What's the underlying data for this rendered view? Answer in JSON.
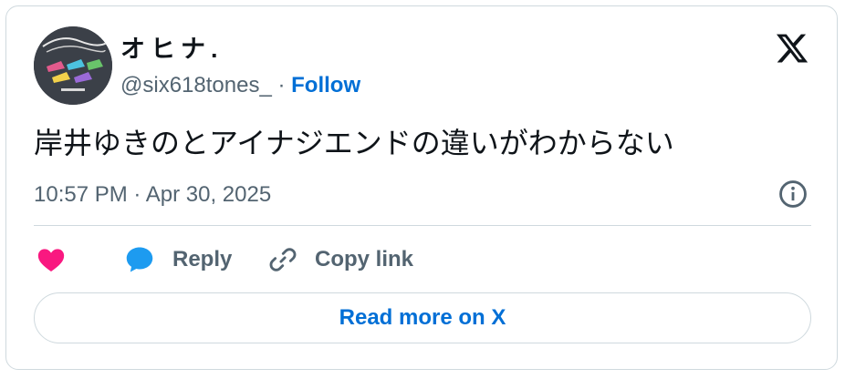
{
  "author": {
    "display_name": "オヒナ.",
    "handle": "@six618tones_",
    "separator": " · ",
    "follow_label": "Follow"
  },
  "tweet": {
    "text": "岸井ゆきのとアイナジエンドの違いがわからない",
    "timestamp": "10:57 PM · Apr 30, 2025"
  },
  "actions": {
    "reply_label": "Reply",
    "copy_link_label": "Copy link"
  },
  "read_more_label": "Read more on X",
  "colors": {
    "like": "#f91880",
    "reply": "#1d9bf0",
    "link": "#006fd6",
    "muted": "#536471",
    "border": "#cfd9de"
  },
  "icons": [
    "x-logo-icon",
    "info-icon",
    "heart-icon",
    "reply-bubble-icon",
    "copy-link-icon"
  ]
}
